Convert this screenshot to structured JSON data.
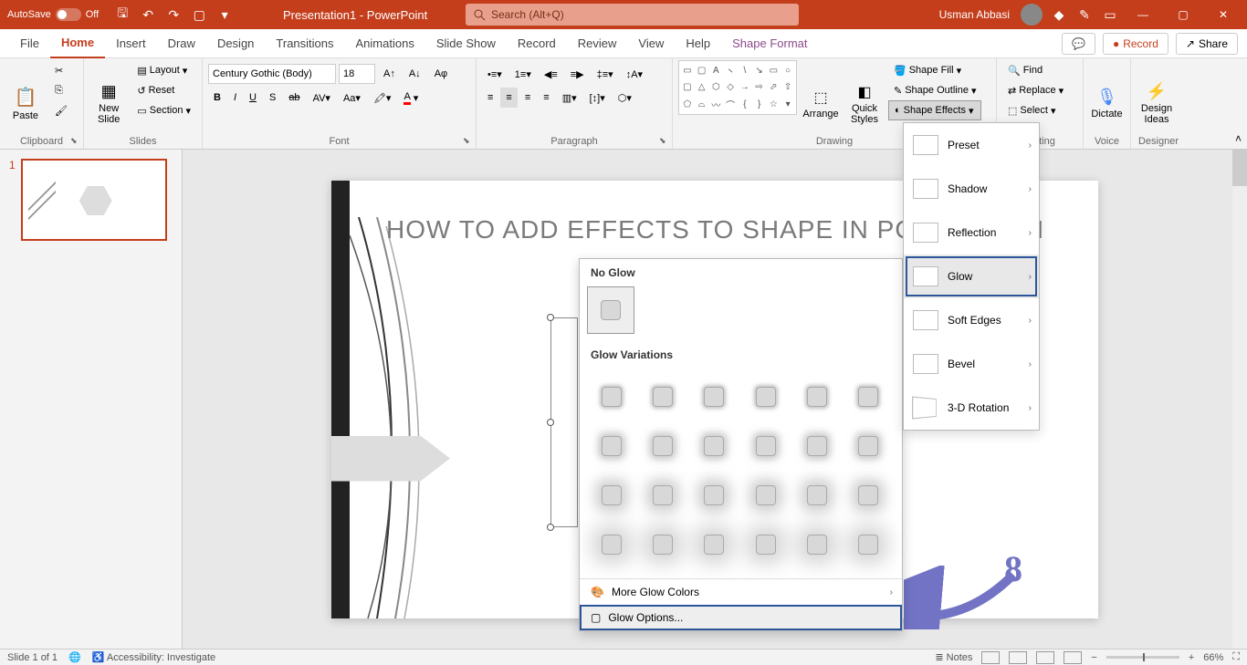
{
  "titlebar": {
    "autosave_label": "AutoSave",
    "autosave_state": "Off",
    "title": "Presentation1 - PowerPoint",
    "search_placeholder": "Search (Alt+Q)",
    "user_name": "Usman Abbasi"
  },
  "tabs": {
    "file": "File",
    "home": "Home",
    "insert": "Insert",
    "draw": "Draw",
    "design": "Design",
    "transitions": "Transitions",
    "animations": "Animations",
    "slideshow": "Slide Show",
    "record": "Record",
    "review": "Review",
    "view": "View",
    "help": "Help",
    "shape_format": "Shape Format",
    "record_btn": "Record",
    "share_btn": "Share"
  },
  "ribbon": {
    "clipboard": {
      "label": "Clipboard",
      "paste": "Paste"
    },
    "slides": {
      "label": "Slides",
      "new_slide": "New\nSlide",
      "layout": "Layout",
      "reset": "Reset",
      "section": "Section"
    },
    "font": {
      "label": "Font",
      "name": "Century Gothic (Body)",
      "size": "18"
    },
    "paragraph": {
      "label": "Paragraph"
    },
    "drawing": {
      "label": "Drawing",
      "arrange": "Arrange",
      "quick_styles": "Quick\nStyles",
      "shape_fill": "Shape Fill",
      "shape_outline": "Shape Outline",
      "shape_effects": "Shape Effects"
    },
    "editing": {
      "label": "Editing",
      "find": "Find",
      "replace": "Replace",
      "select": "Select"
    },
    "voice": {
      "label": "Voice",
      "dictate": "Dictate"
    },
    "designer": {
      "label": "Designer",
      "design_ideas": "Design\nIdeas"
    }
  },
  "effects_menu": {
    "preset": "Preset",
    "shadow": "Shadow",
    "reflection": "Reflection",
    "glow": "Glow",
    "soft_edges": "Soft Edges",
    "bevel": "Bevel",
    "rotation": "3-D Rotation"
  },
  "glow_gallery": {
    "no_glow": "No Glow",
    "variations": "Glow Variations",
    "more_colors": "More Glow Colors",
    "options": "Glow Options..."
  },
  "slide": {
    "title": "HOW TO ADD EFFECTS TO SHAPE IN POWERPOIN",
    "thumb_num": "1"
  },
  "status": {
    "slide_pos": "Slide 1 of 1",
    "accessibility": "Accessibility: Investigate",
    "notes": "Notes",
    "zoom": "66%"
  },
  "annotation": {
    "num": "8"
  }
}
